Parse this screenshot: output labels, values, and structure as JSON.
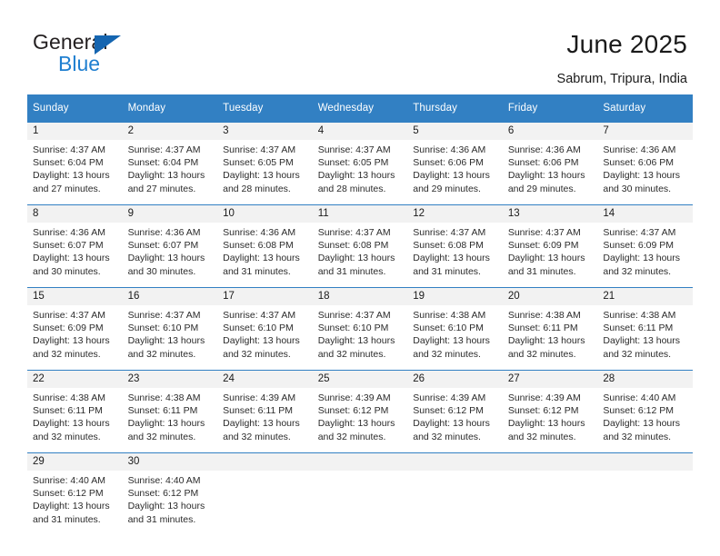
{
  "brand": {
    "name_part1": "General",
    "name_part2": "Blue",
    "triangle_color": "#1565b0",
    "blue_color": "#1f7fd0"
  },
  "header": {
    "title": "June 2025",
    "location": "Sabrum, Tripura, India",
    "header_bg": "#3280c3",
    "daynum_bg": "#f2f2f2"
  },
  "weekdays": [
    "Sunday",
    "Monday",
    "Tuesday",
    "Wednesday",
    "Thursday",
    "Friday",
    "Saturday"
  ],
  "labels": {
    "sunrise": "Sunrise:",
    "sunset": "Sunset:",
    "daylight": "Daylight:"
  },
  "weeks": [
    {
      "days": [
        {
          "num": "1",
          "sunrise": "Sunrise: 4:37 AM",
          "sunset": "Sunset: 6:04 PM",
          "daylight": "Daylight: 13 hours and 27 minutes."
        },
        {
          "num": "2",
          "sunrise": "Sunrise: 4:37 AM",
          "sunset": "Sunset: 6:04 PM",
          "daylight": "Daylight: 13 hours and 27 minutes."
        },
        {
          "num": "3",
          "sunrise": "Sunrise: 4:37 AM",
          "sunset": "Sunset: 6:05 PM",
          "daylight": "Daylight: 13 hours and 28 minutes."
        },
        {
          "num": "4",
          "sunrise": "Sunrise: 4:37 AM",
          "sunset": "Sunset: 6:05 PM",
          "daylight": "Daylight: 13 hours and 28 minutes."
        },
        {
          "num": "5",
          "sunrise": "Sunrise: 4:36 AM",
          "sunset": "Sunset: 6:06 PM",
          "daylight": "Daylight: 13 hours and 29 minutes."
        },
        {
          "num": "6",
          "sunrise": "Sunrise: 4:36 AM",
          "sunset": "Sunset: 6:06 PM",
          "daylight": "Daylight: 13 hours and 29 minutes."
        },
        {
          "num": "7",
          "sunrise": "Sunrise: 4:36 AM",
          "sunset": "Sunset: 6:06 PM",
          "daylight": "Daylight: 13 hours and 30 minutes."
        }
      ]
    },
    {
      "days": [
        {
          "num": "8",
          "sunrise": "Sunrise: 4:36 AM",
          "sunset": "Sunset: 6:07 PM",
          "daylight": "Daylight: 13 hours and 30 minutes."
        },
        {
          "num": "9",
          "sunrise": "Sunrise: 4:36 AM",
          "sunset": "Sunset: 6:07 PM",
          "daylight": "Daylight: 13 hours and 30 minutes."
        },
        {
          "num": "10",
          "sunrise": "Sunrise: 4:36 AM",
          "sunset": "Sunset: 6:08 PM",
          "daylight": "Daylight: 13 hours and 31 minutes."
        },
        {
          "num": "11",
          "sunrise": "Sunrise: 4:37 AM",
          "sunset": "Sunset: 6:08 PM",
          "daylight": "Daylight: 13 hours and 31 minutes."
        },
        {
          "num": "12",
          "sunrise": "Sunrise: 4:37 AM",
          "sunset": "Sunset: 6:08 PM",
          "daylight": "Daylight: 13 hours and 31 minutes."
        },
        {
          "num": "13",
          "sunrise": "Sunrise: 4:37 AM",
          "sunset": "Sunset: 6:09 PM",
          "daylight": "Daylight: 13 hours and 31 minutes."
        },
        {
          "num": "14",
          "sunrise": "Sunrise: 4:37 AM",
          "sunset": "Sunset: 6:09 PM",
          "daylight": "Daylight: 13 hours and 32 minutes."
        }
      ]
    },
    {
      "days": [
        {
          "num": "15",
          "sunrise": "Sunrise: 4:37 AM",
          "sunset": "Sunset: 6:09 PM",
          "daylight": "Daylight: 13 hours and 32 minutes."
        },
        {
          "num": "16",
          "sunrise": "Sunrise: 4:37 AM",
          "sunset": "Sunset: 6:10 PM",
          "daylight": "Daylight: 13 hours and 32 minutes."
        },
        {
          "num": "17",
          "sunrise": "Sunrise: 4:37 AM",
          "sunset": "Sunset: 6:10 PM",
          "daylight": "Daylight: 13 hours and 32 minutes."
        },
        {
          "num": "18",
          "sunrise": "Sunrise: 4:37 AM",
          "sunset": "Sunset: 6:10 PM",
          "daylight": "Daylight: 13 hours and 32 minutes."
        },
        {
          "num": "19",
          "sunrise": "Sunrise: 4:38 AM",
          "sunset": "Sunset: 6:10 PM",
          "daylight": "Daylight: 13 hours and 32 minutes."
        },
        {
          "num": "20",
          "sunrise": "Sunrise: 4:38 AM",
          "sunset": "Sunset: 6:11 PM",
          "daylight": "Daylight: 13 hours and 32 minutes."
        },
        {
          "num": "21",
          "sunrise": "Sunrise: 4:38 AM",
          "sunset": "Sunset: 6:11 PM",
          "daylight": "Daylight: 13 hours and 32 minutes."
        }
      ]
    },
    {
      "days": [
        {
          "num": "22",
          "sunrise": "Sunrise: 4:38 AM",
          "sunset": "Sunset: 6:11 PM",
          "daylight": "Daylight: 13 hours and 32 minutes."
        },
        {
          "num": "23",
          "sunrise": "Sunrise: 4:38 AM",
          "sunset": "Sunset: 6:11 PM",
          "daylight": "Daylight: 13 hours and 32 minutes."
        },
        {
          "num": "24",
          "sunrise": "Sunrise: 4:39 AM",
          "sunset": "Sunset: 6:11 PM",
          "daylight": "Daylight: 13 hours and 32 minutes."
        },
        {
          "num": "25",
          "sunrise": "Sunrise: 4:39 AM",
          "sunset": "Sunset: 6:12 PM",
          "daylight": "Daylight: 13 hours and 32 minutes."
        },
        {
          "num": "26",
          "sunrise": "Sunrise: 4:39 AM",
          "sunset": "Sunset: 6:12 PM",
          "daylight": "Daylight: 13 hours and 32 minutes."
        },
        {
          "num": "27",
          "sunrise": "Sunrise: 4:39 AM",
          "sunset": "Sunset: 6:12 PM",
          "daylight": "Daylight: 13 hours and 32 minutes."
        },
        {
          "num": "28",
          "sunrise": "Sunrise: 4:40 AM",
          "sunset": "Sunset: 6:12 PM",
          "daylight": "Daylight: 13 hours and 32 minutes."
        }
      ]
    },
    {
      "days": [
        {
          "num": "29",
          "sunrise": "Sunrise: 4:40 AM",
          "sunset": "Sunset: 6:12 PM",
          "daylight": "Daylight: 13 hours and 31 minutes."
        },
        {
          "num": "30",
          "sunrise": "Sunrise: 4:40 AM",
          "sunset": "Sunset: 6:12 PM",
          "daylight": "Daylight: 13 hours and 31 minutes."
        },
        {
          "num": "",
          "sunrise": "",
          "sunset": "",
          "daylight": ""
        },
        {
          "num": "",
          "sunrise": "",
          "sunset": "",
          "daylight": ""
        },
        {
          "num": "",
          "sunrise": "",
          "sunset": "",
          "daylight": ""
        },
        {
          "num": "",
          "sunrise": "",
          "sunset": "",
          "daylight": ""
        },
        {
          "num": "",
          "sunrise": "",
          "sunset": "",
          "daylight": ""
        }
      ]
    }
  ]
}
